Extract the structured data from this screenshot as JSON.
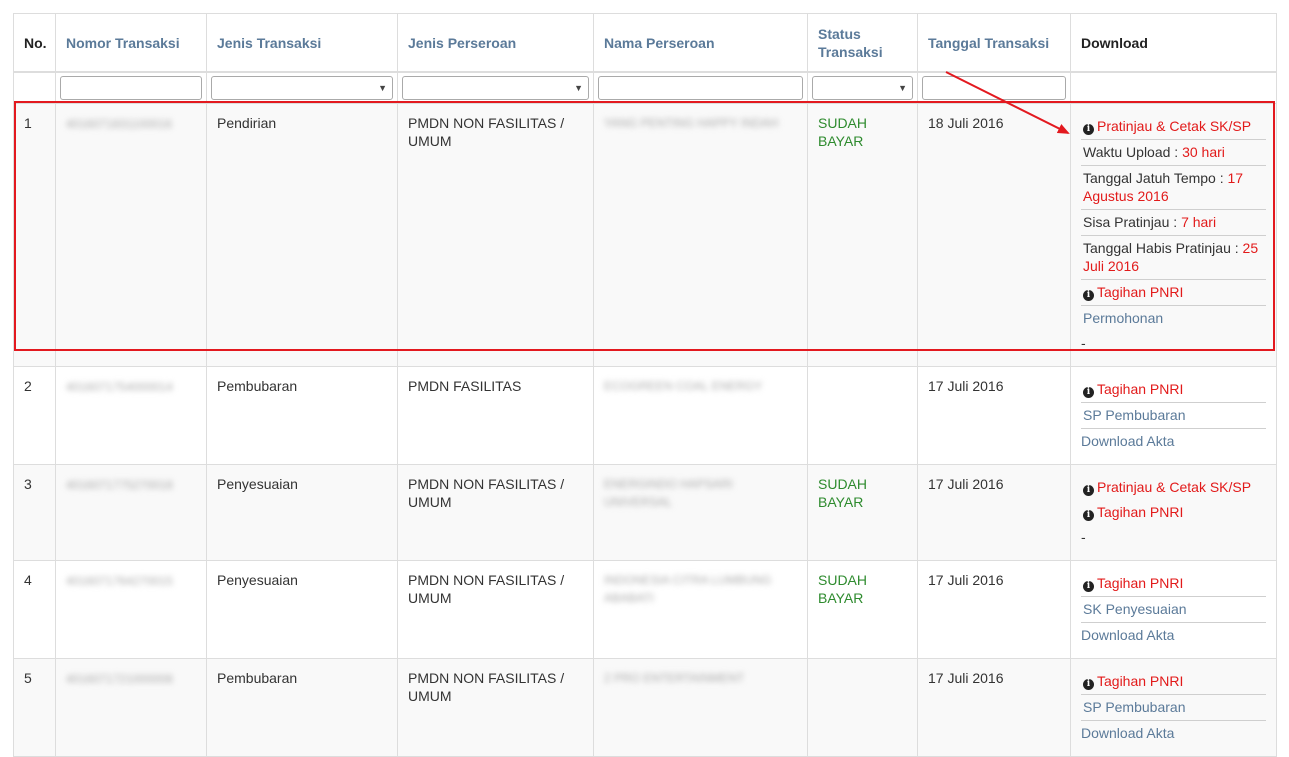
{
  "headers": {
    "no": "No.",
    "nomor": "Nomor Transaksi",
    "jenis_transaksi": "Jenis Transaksi",
    "jenis_perseroan": "Jenis Perseroan",
    "nama_perseroan": "Nama Perseroan",
    "status_line1": "Status",
    "status_line2": "Transaksi",
    "tanggal": "Tanggal Transaksi",
    "download": "Download"
  },
  "rows": [
    {
      "no": "1",
      "nomor": "4016071831100016",
      "jenis_transaksi": "Pendirian",
      "jenis_perseroan_1": "PMDN NON FASILITAS /",
      "jenis_perseroan_2": "UMUM",
      "nama_1": "YANG PENTING HAPPY INDAH",
      "nama_2": "",
      "status_1": "SUDAH",
      "status_2": "BAYAR",
      "tanggal": "18 Juli 2016",
      "dl": {
        "pratinjau": "Pratinjau & Cetak SK/SP",
        "waktu_label": "Waktu Upload : ",
        "waktu_value": "30 hari",
        "jatuh_label": "Tanggal Jatuh Tempo : ",
        "jatuh_value": "17 Agustus 2016",
        "sisa_label": "Sisa Pratinjau : ",
        "sisa_value": "7 hari",
        "habis_label": "Tanggal Habis Pratinjau : ",
        "habis_value": "25 Juli 2016",
        "tagihan": "Tagihan PNRI",
        "permohonan": "Permohonan",
        "dash": "-"
      }
    },
    {
      "no": "2",
      "nomor": "4016071754000014",
      "jenis_transaksi": "Pembubaran",
      "jenis_perseroan_1": "PMDN FASILITAS",
      "jenis_perseroan_2": "",
      "nama_1": "ECOGREEN COAL ENERGY",
      "nama_2": "",
      "status_1": "",
      "status_2": "",
      "tanggal": "17 Juli 2016",
      "dl": {
        "tagihan": "Tagihan PNRI",
        "doc": "SP Pembubaran",
        "akta": "Download Akta"
      }
    },
    {
      "no": "3",
      "nomor": "4016071775270018",
      "jenis_transaksi": "Penyesuaian",
      "jenis_perseroan_1": "PMDN NON FASILITAS /",
      "jenis_perseroan_2": "UMUM",
      "nama_1": "ENERGINDO HAPSARI",
      "nama_2": "UNIVERSAL",
      "status_1": "SUDAH",
      "status_2": "BAYAR",
      "tanggal": "17 Juli 2016",
      "dl": {
        "pratinjau": "Pratinjau & Cetak SK/SP",
        "tagihan": "Tagihan PNRI",
        "dash": "-"
      }
    },
    {
      "no": "4",
      "nomor": "4016071764270015",
      "jenis_transaksi": "Penyesuaian",
      "jenis_perseroan_1": "PMDN NON FASILITAS /",
      "jenis_perseroan_2": "UMUM",
      "nama_1": "INDONESIA CITRA LUMBUNG",
      "nama_2": "ABABATI",
      "status_1": "SUDAH",
      "status_2": "BAYAR",
      "tanggal": "17 Juli 2016",
      "dl": {
        "tagihan": "Tagihan PNRI",
        "doc": "SK Penyesuaian",
        "akta": "Download Akta"
      }
    },
    {
      "no": "5",
      "nomor": "4016071721000008",
      "jenis_transaksi": "Pembubaran",
      "jenis_perseroan_1": "PMDN NON FASILITAS /",
      "jenis_perseroan_2": "UMUM",
      "nama_1": "2 PRO ENTERTAINMENT",
      "nama_2": "",
      "status_1": "",
      "status_2": "",
      "tanggal": "17 Juli 2016",
      "dl": {
        "tagihan": "Tagihan PNRI",
        "doc": "SP Pembubaran",
        "akta": "Download Akta"
      }
    }
  ],
  "colors": {
    "highlight": "#e3191f",
    "link": "#5b7a99",
    "alert": "#e21a1a",
    "paid": "#2e8b2e"
  },
  "icons": {
    "info": "info-circle-icon",
    "dropdown": "caret-down-icon"
  }
}
